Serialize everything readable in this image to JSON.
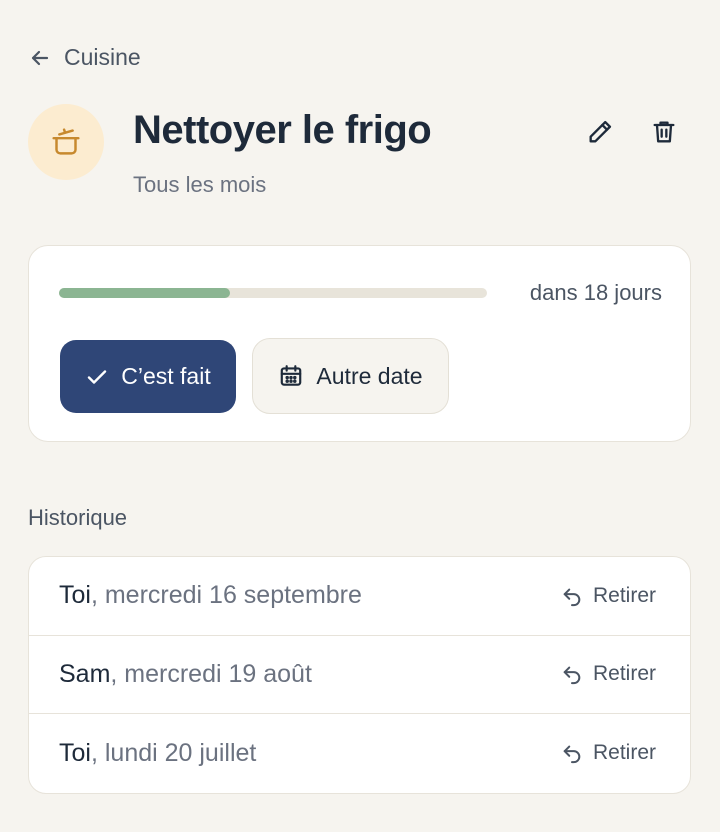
{
  "back": {
    "label": "Cuisine",
    "icon": "arrow-left-icon"
  },
  "task": {
    "title": "Nettoyer le frigo",
    "frequency": "Tous les mois",
    "category_icon": "pot-icon",
    "category_color": "#fcecd0"
  },
  "status": {
    "progress": 0.4,
    "due_text": "dans 18 jours",
    "progress_color": "#8bb592"
  },
  "actions": {
    "done_label": "C’est fait",
    "other_date_label": "Autre date"
  },
  "history": {
    "title": "Historique",
    "undo_label": "Retirer",
    "entries": [
      {
        "name": "Toi",
        "date": ", mercredi 16 septembre"
      },
      {
        "name": "Sam",
        "date": ", mercredi 19 août"
      },
      {
        "name": "Toi",
        "date": ", lundi 20 juillet"
      }
    ]
  },
  "colors": {
    "primary": "#2f4677",
    "background": "#f6f4ef",
    "text": "#1e2a3a"
  }
}
